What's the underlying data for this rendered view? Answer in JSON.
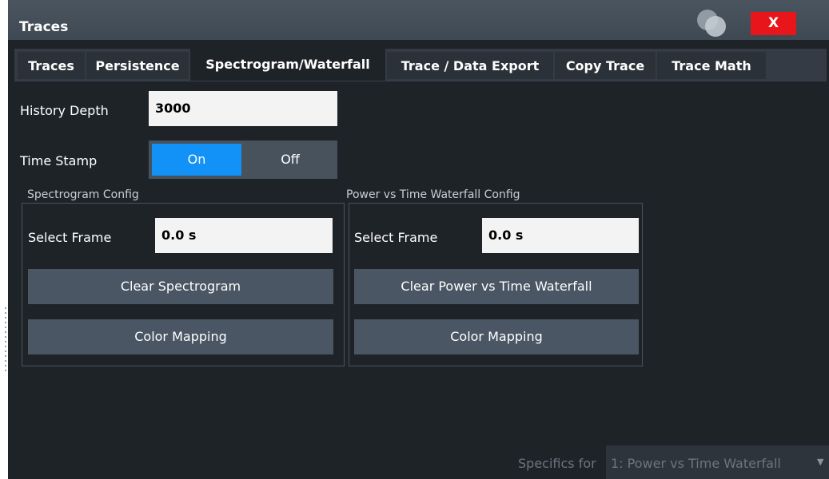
{
  "window": {
    "title": "Traces",
    "close_label": "X"
  },
  "tabs": [
    {
      "label": "Traces"
    },
    {
      "label": "Persistence"
    },
    {
      "label": "Spectrogram/Waterfall"
    },
    {
      "label": "Trace / Data Export"
    },
    {
      "label": "Copy Trace"
    },
    {
      "label": "Trace Math"
    }
  ],
  "active_tab": "Spectrogram/Waterfall",
  "history_depth": {
    "label": "History Depth",
    "value": "3000"
  },
  "time_stamp": {
    "label": "Time Stamp",
    "on_label": "On",
    "off_label": "Off",
    "selected": "On"
  },
  "spectrogram_config": {
    "title": "Spectrogram Config",
    "select_frame_label": "Select Frame",
    "select_frame_value": "0.0 s",
    "clear_label": "Clear Spectrogram",
    "color_mapping_label": "Color Mapping"
  },
  "waterfall_config": {
    "title": "Power vs Time Waterfall Config",
    "select_frame_label": "Select Frame",
    "select_frame_value": "0.0 s",
    "clear_label": "Clear Power vs Time Waterfall",
    "color_mapping_label": "Color Mapping"
  },
  "footer": {
    "specifics_label": "Specifics for",
    "specifics_value": "1: Power vs Time Waterfall"
  },
  "colors": {
    "accent": "#1291f6",
    "close": "#e8161a",
    "background": "#1e2328",
    "button": "#4a5663"
  }
}
